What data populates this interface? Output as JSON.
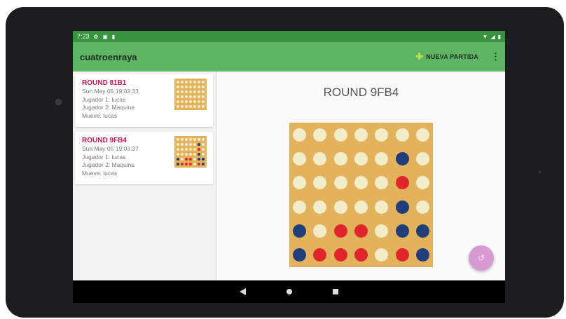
{
  "status_bar": {
    "time": "7:23",
    "left_icons": [
      "gear-icon",
      "square-icon",
      "sd-card-icon"
    ],
    "right_icons": [
      "wifi-icon",
      "signal-icon",
      "battery-icon"
    ]
  },
  "app_bar": {
    "title": "cuatroenraya",
    "new_game_label": "NUEVA PARTIDA",
    "new_game_icon": "plus-icon",
    "overflow_icon": "more-vert-icon"
  },
  "games": [
    {
      "title": "ROUND 81B1",
      "date": "Sun May 05 19:03:33",
      "player1": "Jugador 1: lucas",
      "player2": "Jugador 2: Maquina",
      "turn": "Mueve: lucas",
      "board": [
        "EEEEEEE",
        "EEEEEEE",
        "EEEEEEE",
        "EEEEEEE",
        "EEEEEEE",
        "EEEEEEE"
      ]
    },
    {
      "title": "ROUND 9FB4",
      "date": "Sun May 05 19:03:37",
      "player1": "Jugador 1: lucas",
      "player2": "Jugador 2: Maquina",
      "turn": "Mueve: lucas",
      "board": [
        "EEEEEEE",
        "EEEEEBE",
        "EEEEERE",
        "EEEEEBE",
        "BERREBB",
        "BRRRERB"
      ]
    }
  ],
  "main": {
    "title": "ROUND 9FB4",
    "board": [
      "EEEEEEE",
      "EEEEEBE",
      "EEEEERE",
      "EEEEEBE",
      "BERREBB",
      "BRRRERB"
    ],
    "undo_icon": "undo-icon"
  },
  "nav_bar": {
    "icons": [
      "back-icon",
      "home-icon",
      "recents-icon"
    ]
  },
  "colors": {
    "status_bar": "#37913d",
    "app_bar": "#5fb564",
    "board": "#e3b25c",
    "empty": "#f2ecc9",
    "red": "#e0262d",
    "blue": "#1f3e7a",
    "card_title": "#c2185b",
    "fab": "#d89ad0"
  }
}
